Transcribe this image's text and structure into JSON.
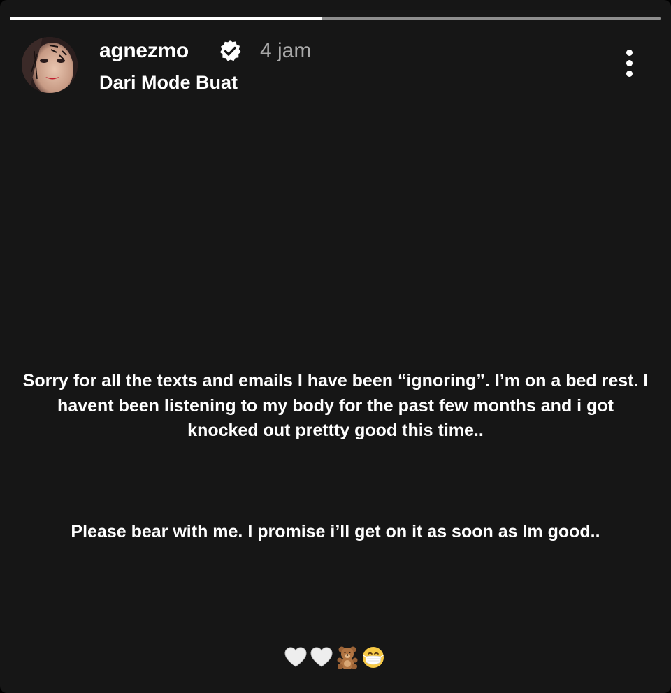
{
  "story": {
    "progress": 0.48,
    "background_color": "#161616",
    "accent_color": "#ffffff"
  },
  "header": {
    "username": "agnezmo",
    "verified_icon": "verified-badge-icon",
    "timestamp": "4 jam",
    "subtitle": "Dari Mode Buat",
    "more_icon": "more-options-icon"
  },
  "content": {
    "paragraphs": [
      "Sorry for all the texts and emails I have been “ignoring”. I’m on a bed rest. I havent been listening to my body for the past few months and i got knocked out prettty good this time..",
      "Please bear with me. I promise i’ll get on it as soon as Im good.."
    ],
    "emojis": [
      "white-heart-icon",
      "white-heart-icon",
      "teddy-bear-icon",
      "face-with-medical-mask-icon"
    ]
  }
}
